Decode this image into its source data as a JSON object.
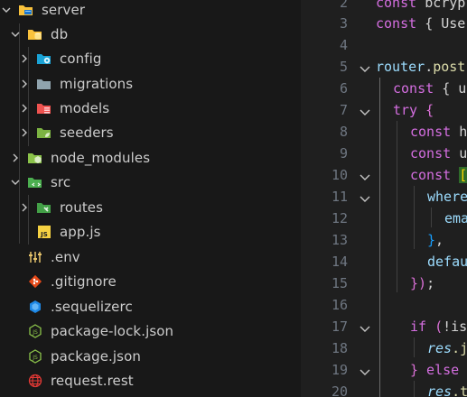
{
  "explorer": {
    "items": [
      {
        "label": "server",
        "icon": "folder-server-icon",
        "chevron": "down"
      },
      {
        "label": "db",
        "icon": "folder-db-icon",
        "chevron": "down"
      },
      {
        "label": "config",
        "icon": "folder-config-icon",
        "chevron": "right"
      },
      {
        "label": "migrations",
        "icon": "folder-icon",
        "chevron": "right"
      },
      {
        "label": "models",
        "icon": "folder-models-icon",
        "chevron": "right"
      },
      {
        "label": "seeders",
        "icon": "folder-seeders-icon",
        "chevron": "right"
      },
      {
        "label": "node_modules",
        "icon": "folder-node-icon",
        "chevron": "right"
      },
      {
        "label": "src",
        "icon": "folder-src-icon",
        "chevron": "down"
      },
      {
        "label": "routes",
        "icon": "folder-routes-icon",
        "chevron": "right"
      },
      {
        "label": "app.js",
        "icon": "js-file-icon",
        "chevron": ""
      },
      {
        "label": ".env",
        "icon": "env-file-icon",
        "chevron": ""
      },
      {
        "label": ".gitignore",
        "icon": "git-icon",
        "chevron": ""
      },
      {
        "label": ".sequelizerc",
        "icon": "sequelize-icon",
        "chevron": ""
      },
      {
        "label": "package-lock.json",
        "icon": "nodejs-icon",
        "chevron": ""
      },
      {
        "label": "package.json",
        "icon": "nodejs-icon",
        "chevron": ""
      },
      {
        "label": "request.rest",
        "icon": "globe-icon",
        "chevron": ""
      }
    ]
  },
  "editor": {
    "line_numbers": [
      "2",
      "3",
      "4",
      "5",
      "6",
      "7",
      "8",
      "9",
      "10",
      "11",
      "12",
      "13",
      "14",
      "15",
      "16",
      "17",
      "18",
      "19",
      "20"
    ],
    "code": {
      "l2_kw": "const ",
      "l2_rest": "bcryp",
      "l3_kw": "const ",
      "l3_rest": "{ Use",
      "l5_var": "router",
      "l5_dot": ".",
      "l5_fn": "post",
      "l6_kw": "const ",
      "l6_rest": "{ u",
      "l7_kw": "try ",
      "l7_br": "{",
      "l8_kw": "const ",
      "l8_rest": "h",
      "l9_kw": "const ",
      "l9_rest": "u",
      "l10_kw": "const ",
      "l10_rest": "[",
      "l11_rest": "where",
      "l12_rest": "ema",
      "l13_br": "}",
      "l13_rest": ",",
      "l14_rest": "defau",
      "l15_br": "}",
      "l15_br2": ")",
      "l15_rest": ";",
      "l17_kw": "if ",
      "l17_br": "(",
      "l17_rest": "!is",
      "l18_it": "res",
      "l18_rest": ".j",
      "l19_br": "}",
      "l19_kw": " else",
      "l20_it": "res",
      "l20_rest": ".t"
    }
  },
  "colors": {
    "explorer_bg": "#181818",
    "editor_bg": "#1f1f1f",
    "keyword": "#d46ee0",
    "function": "#dcdcaa",
    "variable": "#9cdcfe"
  }
}
